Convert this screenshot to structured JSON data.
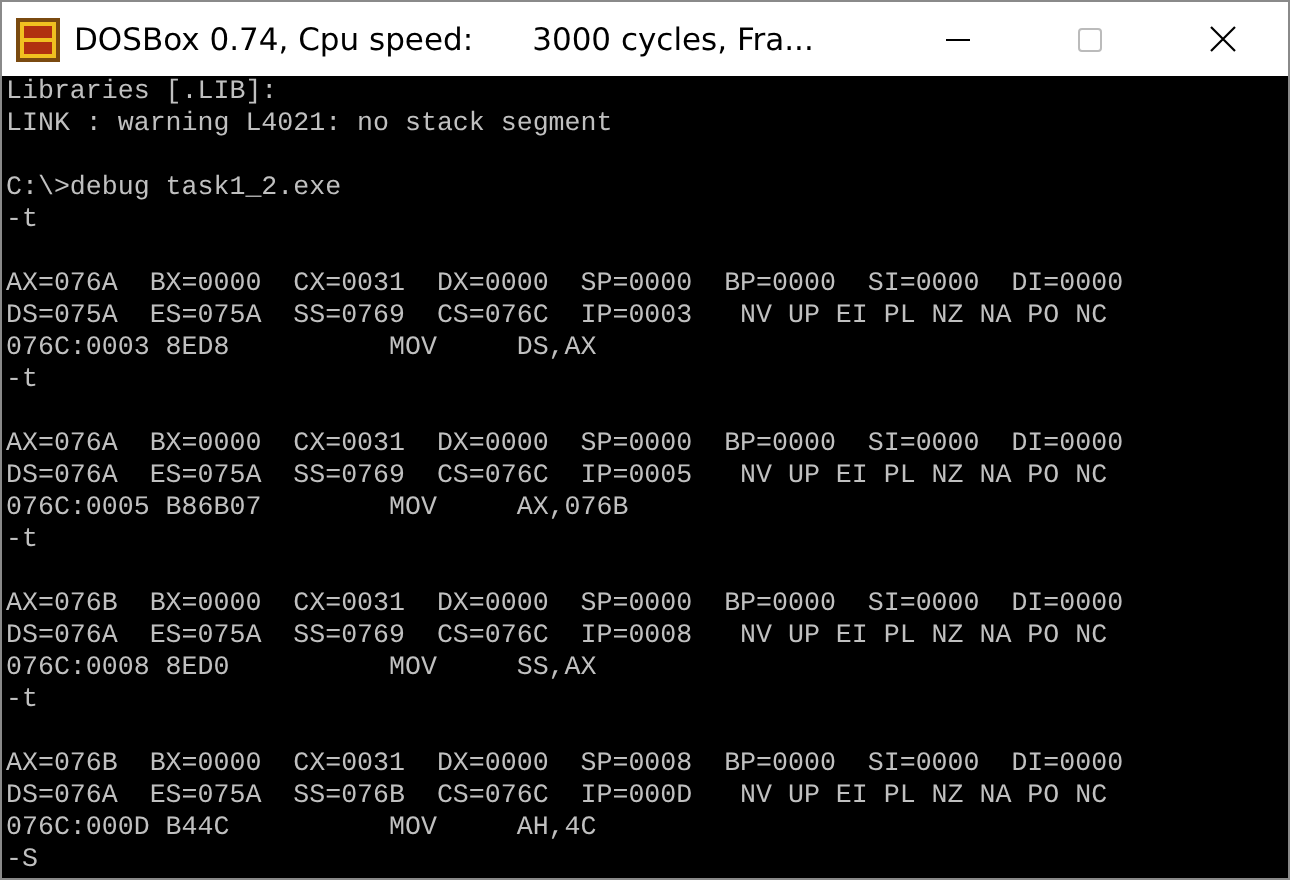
{
  "window": {
    "title": "DOSBox 0.74, Cpu speed:      3000 cycles, Fra..."
  },
  "console": {
    "lines": [
      {
        "kind": "text",
        "text": "Libraries [.LIB]:"
      },
      {
        "kind": "text",
        "text": "LINK : warning L4021: no stack segment"
      },
      {
        "kind": "blank"
      },
      {
        "kind": "text",
        "text": "C:\\>debug task1_2.exe"
      },
      {
        "kind": "text",
        "text": "-t"
      },
      {
        "kind": "blank"
      },
      {
        "kind": "text",
        "text": "AX=076A  BX=0000  CX=0031  DX=0000  SP=0000  BP=0000  SI=0000  DI=0000"
      },
      {
        "kind": "text",
        "text": "DS=075A  ES=075A  SS=0769  CS=076C  IP=0003   NV UP EI PL NZ NA PO NC"
      },
      {
        "kind": "text",
        "text": "076C:0003 8ED8          MOV     DS,AX"
      },
      {
        "kind": "text",
        "text": "-t"
      },
      {
        "kind": "blank"
      },
      {
        "kind": "text",
        "text": "AX=076A  BX=0000  CX=0031  DX=0000  SP=0000  BP=0000  SI=0000  DI=0000"
      },
      {
        "kind": "text",
        "text": "DS=076A  ES=075A  SS=0769  CS=076C  IP=0005   NV UP EI PL NZ NA PO NC"
      },
      {
        "kind": "text",
        "text": "076C:0005 B86B07        MOV     AX,076B"
      },
      {
        "kind": "text",
        "text": "-t"
      },
      {
        "kind": "blank"
      },
      {
        "kind": "text",
        "text": "AX=076B  BX=0000  CX=0031  DX=0000  SP=0000  BP=0000  SI=0000  DI=0000"
      },
      {
        "kind": "text",
        "text": "DS=076A  ES=075A  SS=0769  CS=076C  IP=0008   NV UP EI PL NZ NA PO NC"
      },
      {
        "kind": "text",
        "text": "076C:0008 8ED0          MOV     SS,AX"
      },
      {
        "kind": "text",
        "text": "-t"
      },
      {
        "kind": "blank"
      },
      {
        "kind": "text",
        "text": "AX=076B  BX=0000  CX=0031  DX=0000  SP=0008  BP=0000  SI=0000  DI=0000"
      },
      {
        "kind": "text",
        "text": "DS=076A  ES=075A  SS=076B  CS=076C  IP=000D   NV UP EI PL NZ NA PO NC"
      },
      {
        "kind": "text",
        "text": "076C:000D B44C          MOV     AH,4C"
      },
      {
        "kind": "text",
        "text": "-S"
      }
    ]
  }
}
